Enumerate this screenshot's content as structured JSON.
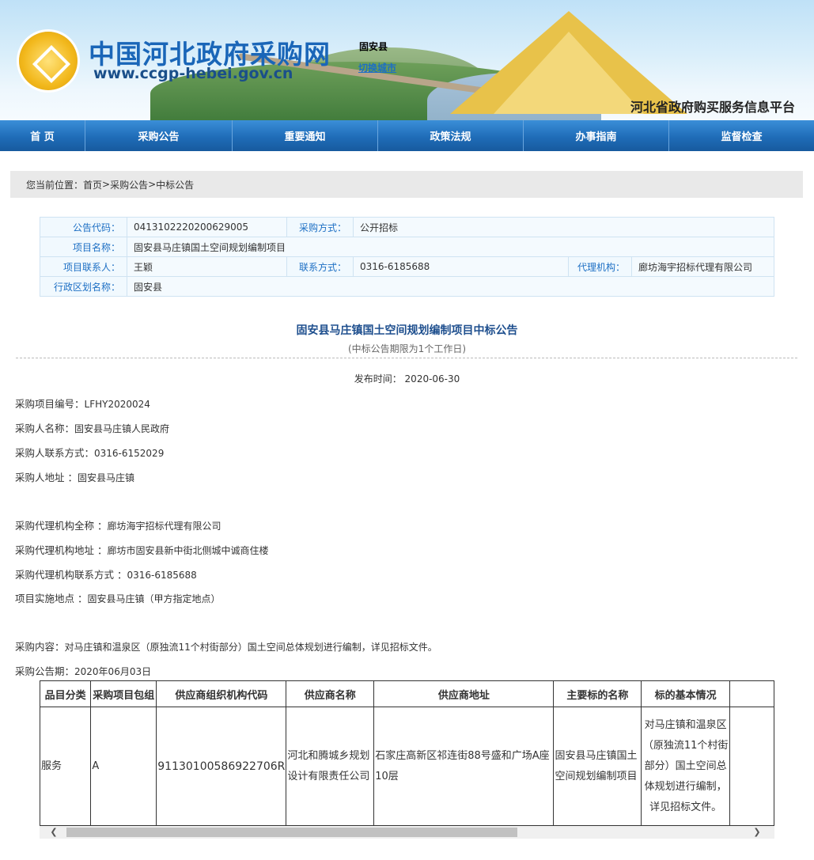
{
  "header": {
    "site_title": "中国河北政府采购网",
    "site_url": "www.ccgp-hebei.gov.cn",
    "city": "固安县",
    "switch_city": "切换城市",
    "platform": "河北省政府购买服务信息平台"
  },
  "nav": [
    "首 页",
    "采购公告",
    "重要通知",
    "政策法规",
    "办事指南",
    "监督检查"
  ],
  "breadcrumb": {
    "prefix": "您当前位置：",
    "home": "首页",
    "sep1": " > ",
    "section": "采购公告",
    "sep2": " > ",
    "current": "中标公告"
  },
  "info": {
    "code_label": "公告代码：",
    "code_value": "0413102220200629005",
    "method_label": "采购方式：",
    "method_value": "公开招标",
    "project_label": "项目名称：",
    "project_value": "固安县马庄镇国土空间规划编制项目",
    "contact_label": "项目联系人：",
    "contact_value": "王颖",
    "phone_label": "联系方式：",
    "phone_value": "0316-6185688",
    "agency_label": "代理机构：",
    "agency_value": "廊坊海宇招标代理有限公司",
    "region_label": "行政区划名称：",
    "region_value": "固安县"
  },
  "announcement": {
    "title": "固安县马庄镇国土空间规划编制项目中标公告",
    "subtitle": "(中标公告期限为1个工作日)",
    "publish_label": "发布时间：",
    "publish_date": "2020-06-30"
  },
  "details": {
    "l1k": "采购项目编号：",
    "l1v": "LFHY2020024",
    "l2k": "采购人名称：",
    "l2v": "固安县马庄镇人民政府",
    "l3k": "采购人联系方式：",
    "l3v": "0316-6152029",
    "l4k": "采购人地址 ：",
    "l4v": "固安县马庄镇",
    "l5k": "采购代理机构全称 ：",
    "l5v": "廊坊海宇招标代理有限公司",
    "l6k": "采购代理机构地址 ：",
    "l6v": "廊坊市固安县新中街北侧城中诚商住楼",
    "l7k": "采购代理机构联系方式 ：",
    "l7v": "0316-6185688",
    "l8k": "项目实施地点 ：",
    "l8v": "固安县马庄镇（甲方指定地点）",
    "l9k": "采购内容：",
    "l9v": "对马庄镇和温泉区（原独流11个村街部分）国土空间总体规划进行编制，详见招标文件。",
    "l10k": "采购公告期：",
    "l10v": "2020年06月03日"
  },
  "result_table": {
    "headers": [
      "品目分类",
      "采购项目包组",
      "供应商组织机构代码",
      "供应商名称",
      "供应商地址",
      "主要标的名称",
      "标的基本情况"
    ],
    "row": {
      "category": "服务",
      "package": "A",
      "org_code": "91130100586922706R",
      "supplier": "河北和腾城乡规划设计有限责任公司",
      "address": "石家庄高新区祁连街88号盛和广场A座10层",
      "item": "固安县马庄镇国土空间规划编制项目",
      "desc": "对马庄镇和温泉区（原独流11个村街部分）国土空间总体规划进行编制，详见招标文件。"
    }
  }
}
